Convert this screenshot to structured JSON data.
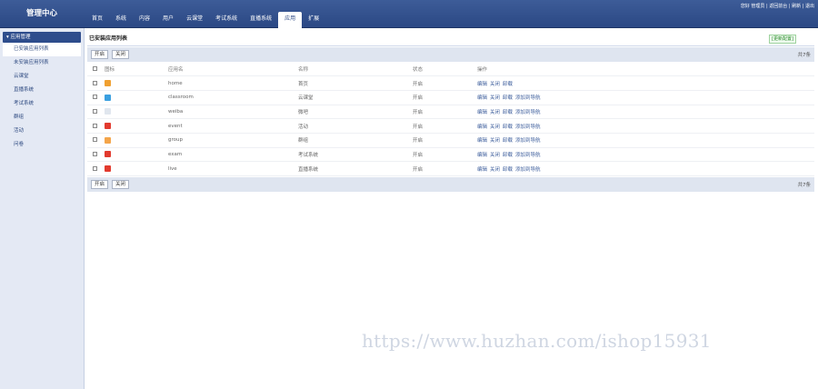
{
  "header": {
    "logo": "管理中心",
    "nav": [
      "首页",
      "系统",
      "内容",
      "用户",
      "云课堂",
      "考试系统",
      "直播系统",
      "应用",
      "扩展"
    ],
    "active_nav": 7,
    "toplinks": "您好 管理员 | 返回前台 | 刷新 | 退出"
  },
  "sidebar": {
    "section": "应用管理",
    "items": [
      {
        "label": "已安装应用列表",
        "active": true
      },
      {
        "label": "未安装应用列表",
        "active": false
      },
      {
        "label": "云课堂",
        "active": false
      },
      {
        "label": "直播系统",
        "active": false
      },
      {
        "label": "考试系统",
        "active": false
      },
      {
        "label": "群组",
        "active": false
      },
      {
        "label": "活动",
        "active": false
      },
      {
        "label": "问卷",
        "active": false
      }
    ]
  },
  "main": {
    "title": "已安装应用列表",
    "update_badge": "[更新配置]",
    "toolbar": {
      "open": "开启",
      "close": "关闭",
      "count": "共7条"
    },
    "columns": [
      "图标",
      "应用名",
      "名称",
      "状态",
      "操作"
    ],
    "rows": [
      {
        "app": "home",
        "name": "首页",
        "status": "开启",
        "icon_color": "#f0a030",
        "ops": [
          "编辑",
          "关闭",
          "卸载"
        ]
      },
      {
        "app": "classroom",
        "name": "云课堂",
        "status": "开启",
        "icon_color": "#3aa0e0",
        "ops": [
          "编辑",
          "关闭",
          "卸载",
          "添加到导航"
        ]
      },
      {
        "app": "weiba",
        "name": "微吧",
        "status": "开启",
        "icon_color": "#e0e6ee",
        "ops": [
          "编辑",
          "关闭",
          "卸载",
          "添加到导航"
        ]
      },
      {
        "app": "event",
        "name": "活动",
        "status": "开启",
        "icon_color": "#e23a2e",
        "ops": [
          "编辑",
          "关闭",
          "卸载",
          "添加到导航"
        ]
      },
      {
        "app": "group",
        "name": "群组",
        "status": "开启",
        "icon_color": "#f4a54a",
        "ops": [
          "编辑",
          "关闭",
          "卸载",
          "添加到导航"
        ]
      },
      {
        "app": "exam",
        "name": "考试系统",
        "status": "开启",
        "icon_color": "#e23a2e",
        "ops": [
          "编辑",
          "关闭",
          "卸载",
          "添加到导航"
        ]
      },
      {
        "app": "live",
        "name": "直播系统",
        "status": "开启",
        "icon_color": "#e23a2e",
        "ops": [
          "编辑",
          "关闭",
          "卸载",
          "添加到导航"
        ]
      }
    ],
    "footer": {
      "open": "开启",
      "close": "关闭",
      "count": "共7条"
    }
  },
  "watermark": "https://www.huzhan.com/ishop15931"
}
